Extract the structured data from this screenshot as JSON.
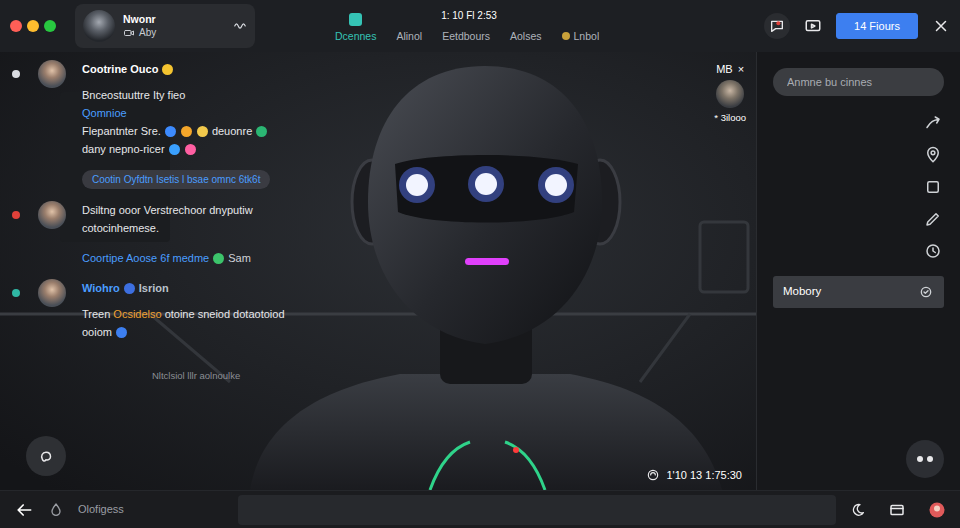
{
  "window": {
    "controls": [
      {
        "color": "#ff5f57"
      },
      {
        "color": "#febc2e"
      },
      {
        "color": "#28c840"
      }
    ]
  },
  "user": {
    "name": "Nwonr",
    "status": "Aby"
  },
  "clock": "1: 10 Fl 2:53",
  "tabs": [
    {
      "label": "Dcennes",
      "selected": true
    },
    {
      "label": "Alinol",
      "selected": false
    },
    {
      "label": "Eetdbours",
      "selected": false
    },
    {
      "label": "Aolses",
      "selected": false
    },
    {
      "label": "Lnbol",
      "selected": false
    }
  ],
  "header_button": "14 Fiours",
  "chat": [
    {
      "kind": "message",
      "indicator": "#d9dce1",
      "author": [
        {
          "kind": "text",
          "text": "Cootrine Ouco",
          "color": "#ffffff"
        },
        {
          "kind": "emoji",
          "color": "#f4c430"
        }
      ],
      "lines": [
        [
          {
            "kind": "text",
            "text": "Bnceostuuttre Ity fieo",
            "color": "#e6e7ea"
          }
        ],
        [
          {
            "kind": "text",
            "text": "Qomnioe",
            "color": "#4a9dff"
          }
        ],
        [
          {
            "kind": "text",
            "text": "Flepantnter Sre.",
            "color": "#e6e7ea"
          },
          {
            "kind": "emoji",
            "color": "#3d8bff"
          },
          {
            "kind": "emoji",
            "color": "#f4a62a"
          },
          {
            "kind": "emoji",
            "color": "#f2c94c"
          },
          {
            "kind": "text",
            "text": "deuonre",
            "color": "#e6e7ea"
          },
          {
            "kind": "emoji",
            "color": "#2bb673"
          }
        ],
        [
          {
            "kind": "text",
            "text": "dany nepno-ricer",
            "color": "#e6e7ea"
          },
          {
            "kind": "emoji",
            "color": "#3aa0ff"
          },
          {
            "kind": "emoji",
            "color": "#ff5fa2"
          }
        ]
      ]
    },
    {
      "kind": "link",
      "segments": [
        {
          "kind": "text",
          "text": "Cootin Oyfdtn Isetis l bsae omnc 6tk6t",
          "color": "#4a9dff"
        }
      ]
    },
    {
      "kind": "message",
      "indicator": "#e0413a",
      "author": [],
      "lines": [
        [
          {
            "kind": "text",
            "text": "Dsiltng ooor Verstrechoor dnyputiw",
            "color": "#e6e7ea"
          }
        ],
        [
          {
            "kind": "text",
            "text": "cotocinhemese.",
            "color": "#e6e7ea"
          }
        ]
      ]
    },
    {
      "kind": "note",
      "segments": [
        {
          "kind": "text",
          "text": "Coortipe Aoose 6f medme",
          "color": "#4a9dff"
        },
        {
          "kind": "emoji",
          "color": "#3cc46b"
        },
        {
          "kind": "text",
          "text": "Sam",
          "color": "#cfd3d8"
        }
      ]
    },
    {
      "kind": "message",
      "indicator": "#2fb7a4",
      "author": [
        {
          "kind": "text",
          "text": "Wiohro",
          "color": "#4a9dff"
        },
        {
          "kind": "emoji",
          "color": "#3d6fe0"
        },
        {
          "kind": "text",
          "text": "Isrion",
          "color": "#b9c2cc"
        }
      ],
      "lines": [
        [
          {
            "kind": "text",
            "text": "Treen",
            "color": "#e6e7ea"
          },
          {
            "kind": "text",
            "text": "Ocsidelso",
            "color": "#f0a030"
          },
          {
            "kind": "text",
            "text": "otoine sneiod dotaotoiod",
            "color": "#e6e7ea"
          }
        ],
        [
          {
            "kind": "text",
            "text": "ooiom",
            "color": "#e6e7ea"
          },
          {
            "kind": "emoji",
            "color": "#3d7ff0"
          }
        ]
      ]
    },
    {
      "kind": "caption",
      "segments": [
        {
          "kind": "text",
          "text": "Nltclsiol lllr aolnoulke",
          "color": "#8b8e94"
        }
      ]
    }
  ],
  "video": {
    "badge": "MB",
    "badge_close": "×",
    "viewer": "* 3ilooo",
    "timestamp": "1'10 13 1:75:30"
  },
  "sidebar": {
    "search": {
      "placeholder": "Anmne bu cinnes"
    },
    "items": [
      {
        "label": "Mobory",
        "selected": true
      }
    ]
  },
  "bottom_bar": {
    "label": "Olofigess"
  }
}
